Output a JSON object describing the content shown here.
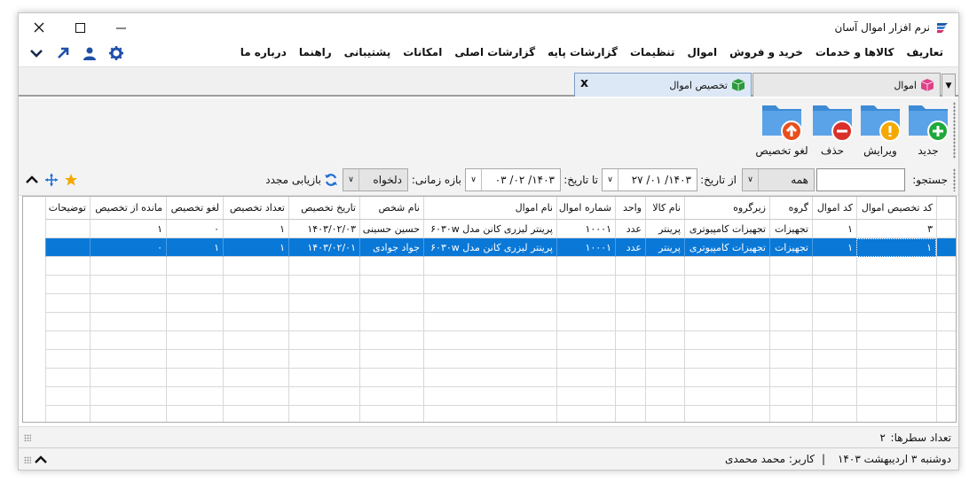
{
  "window": {
    "title": "نرم افزار اموال آسان"
  },
  "menu": {
    "items": [
      "تعاریف",
      "کالاها و خدمات",
      "خرید و فروش",
      "اموال",
      "تنظیمات",
      "گزارشات پایه",
      "گزارشات اصلی",
      "امکانات",
      "پشتیبانی",
      "راهنما",
      "درباره ما"
    ]
  },
  "tabs": {
    "amval": "اموال",
    "takhsis": "تخصیص اموال",
    "close": "x"
  },
  "toolbar": {
    "new": "جدید",
    "edit": "ویرایش",
    "delete": "حذف",
    "cancel": "لغو تخصیص"
  },
  "filter": {
    "search_label": "جستجو:",
    "search_value": "",
    "filter_value": "همه",
    "from_label": "از تاریخ:",
    "from_value": "۱۴۰۳/ ۰۱/ ۲۷",
    "to_label": "تا تاریخ:",
    "to_value": "۱۴۰۳/ ۰۲/ ۰۳",
    "range_label": "بازه زمانی:",
    "range_value": "دلخواه",
    "refresh": "بازیابی مجدد"
  },
  "table": {
    "headers": [
      "کد تخصیص اموال",
      "کد اموال",
      "گروه",
      "زیرگروه",
      "نام کالا",
      "واحد",
      "شماره اموال",
      "نام اموال",
      "نام شخص",
      "تاریخ تخصیص",
      "تعداد تخصیص",
      "لغو تخصیص",
      "مانده از تخصیص",
      "توضیحات"
    ],
    "rows": [
      [
        "۳",
        "۱",
        "تجهیزات",
        "تجهیزات کامپیوتری",
        "پرینتر",
        "عدد",
        "۱۰۰۰۱",
        "پرینتر لیزری کانن مدل ۶۰۳۰w",
        "حسین حسینی",
        "۱۴۰۳/۰۲/۰۳",
        "۱",
        "۰",
        "۱",
        ""
      ],
      [
        "۱",
        "۱",
        "تجهیزات",
        "تجهیزات کامپیوتری",
        "پرینتر",
        "عدد",
        "۱۰۰۰۱",
        "پرینتر لیزری کانن مدل ۶۰۳۰w",
        "جواد جوادی",
        "۱۴۰۳/۰۲/۰۱",
        "۱",
        "۱",
        "۰",
        ""
      ]
    ],
    "selected_row": 1
  },
  "footer": {
    "row_count_label": "تعداد سطرها:",
    "row_count": "۲",
    "date": "دوشنبه ۳ اردیبهشت ۱۴۰۳",
    "separator": "|",
    "user_label": "کاربر: محمد محمدی"
  },
  "colors": {
    "accent": "#0a78d7",
    "folder": "#3d8bd6",
    "green": "#1fa83a",
    "orange": "#f5a800",
    "red": "#d9302c"
  }
}
